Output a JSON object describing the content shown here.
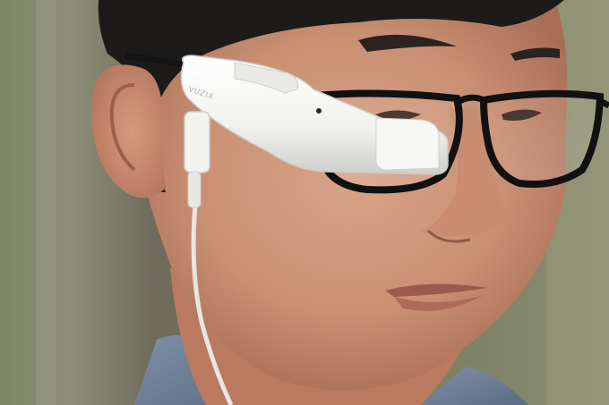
{
  "photo": {
    "device_brand": "VUZIX"
  }
}
